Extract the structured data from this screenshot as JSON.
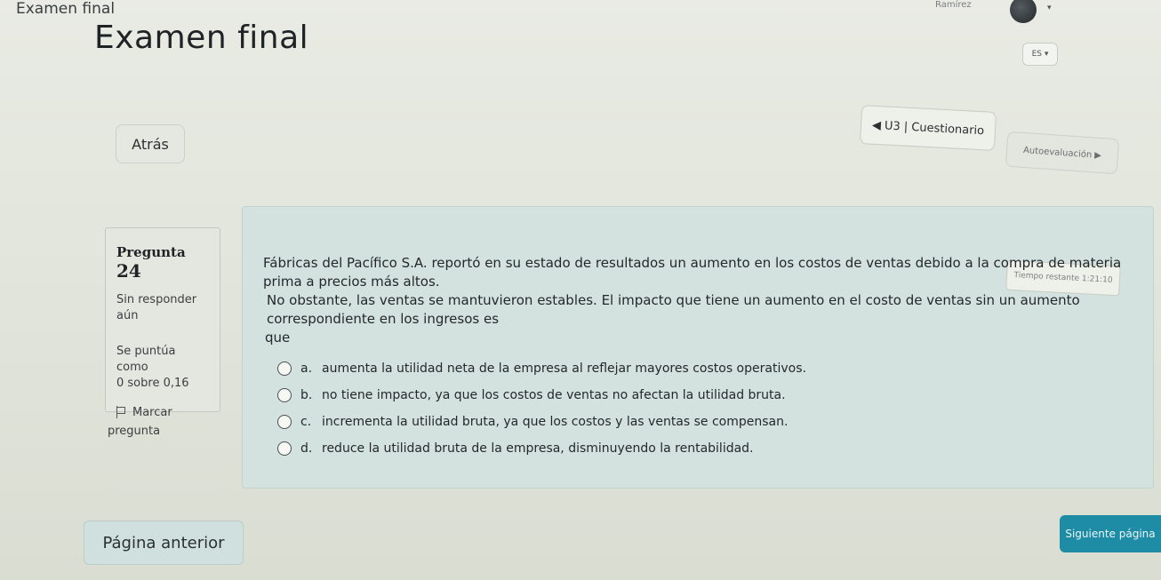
{
  "header": {
    "crumb": "Examen final",
    "title": "Examen final",
    "user_name": "Ramírez",
    "lang_label": "ES"
  },
  "nav": {
    "back_label": "Atrás",
    "prev_activity_label": "U3 | Cuestionario",
    "next_activity_label": "Autoevaluación"
  },
  "question": {
    "heading_prefix": "Pregunta",
    "number": "24",
    "status": "Sin responder aún",
    "points_label": "Se puntúa como",
    "points_value": "0 sobre 0,16",
    "flag_label": "Marcar",
    "flag_label2": "pregunta",
    "text_line1": "Fábricas del Pacífico S.A. reportó en su estado de resultados un aumento en los costos de ventas debido a la compra de materia prima a precios más altos.",
    "text_line2": "No obstante, las ventas se mantuvieron estables. El impacto que tiene un aumento en el costo de ventas sin un aumento correspondiente en los ingresos es",
    "text_line3": "que",
    "options": [
      {
        "letter": "a.",
        "text": "aumenta la utilidad neta de la empresa al reflejar mayores costos operativos."
      },
      {
        "letter": "b.",
        "text": "no tiene impacto, ya que los costos de ventas no afectan la utilidad bruta."
      },
      {
        "letter": "c.",
        "text": "incrementa la utilidad bruta, ya que los costos y las ventas se compensan."
      },
      {
        "letter": "d.",
        "text": "reduce la utilidad bruta de la empresa, disminuyendo la rentabilidad."
      }
    ]
  },
  "timer": {
    "label": "Tiempo restante 1:21:10"
  },
  "footer": {
    "prev_page_label": "Página anterior",
    "next_page_label": "Siguiente página"
  }
}
